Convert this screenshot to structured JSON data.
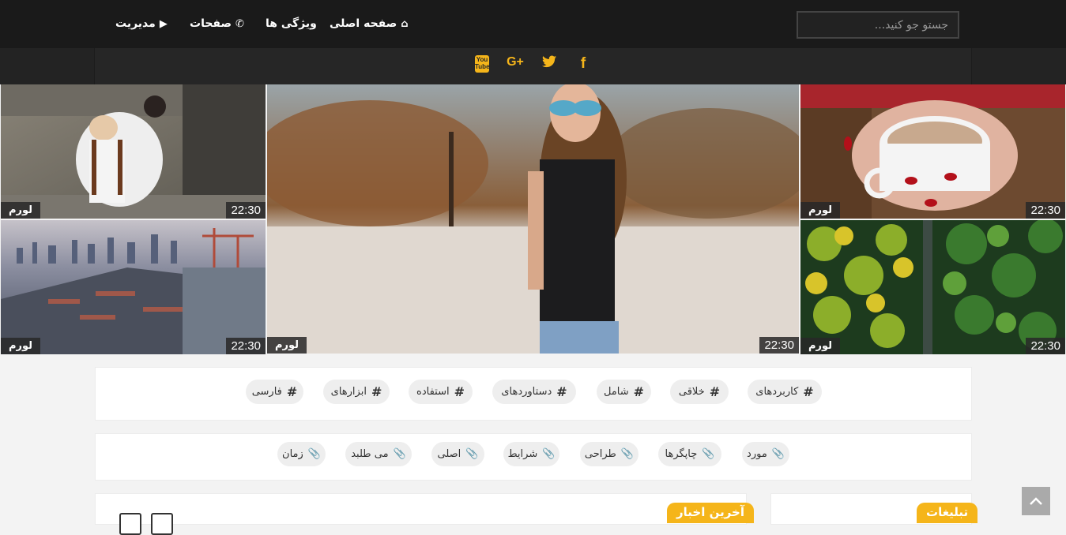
{
  "nav": {
    "items": [
      {
        "label": "صفحه اصلی",
        "icon": "home-icon",
        "glyph": "⌂"
      },
      {
        "label": "ویژگی ها",
        "icon": "",
        "glyph": ""
      },
      {
        "label": "صفحات",
        "icon": "phone-icon",
        "glyph": "✆"
      },
      {
        "label": "مدیریت",
        "icon": "play-circle-icon",
        "glyph": "▶"
      }
    ],
    "search_placeholder": "جستو جو کنید..."
  },
  "social": [
    {
      "name": "youtube-icon",
      "glyph": "You\nTube"
    },
    {
      "name": "google-plus-icon",
      "glyph": "G+"
    },
    {
      "name": "twitter-icon",
      "glyph": "🐦"
    },
    {
      "name": "facebook-icon",
      "glyph": "f"
    }
  ],
  "gallery": [
    {
      "name": "wedding",
      "time": "22:30",
      "category": "لورم"
    },
    {
      "name": "port-city",
      "time": "22:30",
      "category": "لورم"
    },
    {
      "name": "girl-beach",
      "time": "22:30",
      "category": "لورم"
    },
    {
      "name": "coffee-cup",
      "time": "22:30",
      "category": "لورم"
    },
    {
      "name": "forest-aerial",
      "time": "22:30",
      "category": "لورم"
    }
  ],
  "hashtags": [
    "کاربردهای",
    "خلاقی",
    "شامل",
    "دستاوردهای",
    "استفاده",
    "ابزارهای",
    "فارسی"
  ],
  "keywords": [
    "مورد",
    "چاپگرها",
    "طراحی",
    "شرایط",
    "اصلی",
    "می طلبد",
    "زمان"
  ],
  "panels": {
    "latest_news": "آخرین اخبار",
    "ads": "تبلیغات"
  },
  "colors": {
    "accent": "#f5b51a",
    "nav_bg": "#1a1a1a"
  }
}
